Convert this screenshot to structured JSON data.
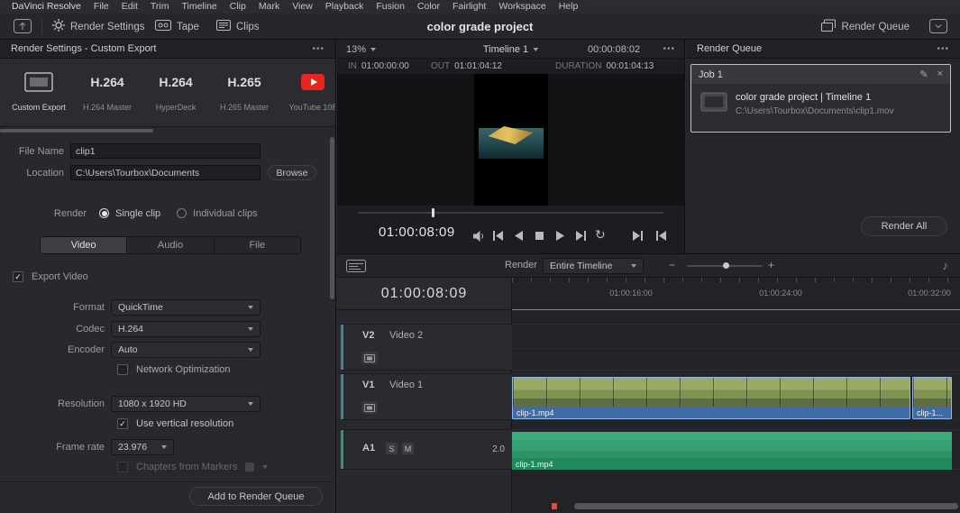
{
  "icons": {
    "more": "•••",
    "loop": "↻",
    "music": "♪",
    "edit": "✎",
    "close": "×",
    "minus": "−",
    "plus": "+",
    "check": "✓"
  },
  "menu": {
    "items": [
      "DaVinci Resolve",
      "File",
      "Edit",
      "Trim",
      "Timeline",
      "Clip",
      "Mark",
      "View",
      "Playback",
      "Fusion",
      "Color",
      "Fairlight",
      "Workspace",
      "Help"
    ]
  },
  "toolbar": {
    "render_settings": "Render Settings",
    "tape": "Tape",
    "clips": "Clips",
    "title": "color grade project",
    "render_queue": "Render Queue"
  },
  "render_settings": {
    "header": "Render Settings - Custom Export",
    "presets": [
      {
        "title": "",
        "caption": "Custom Export"
      },
      {
        "title": "H.264",
        "caption": "H.264 Master"
      },
      {
        "title": "H.264",
        "caption": "HyperDeck"
      },
      {
        "title": "H.265",
        "caption": "H.265 Master"
      },
      {
        "title": "",
        "caption": "YouTube 108"
      }
    ],
    "file_name": {
      "label": "File Name",
      "value": "clip1"
    },
    "location": {
      "label": "Location",
      "value": "C:\\Users\\Tourbox\\Documents",
      "browse": "Browse"
    },
    "render": {
      "label": "Render",
      "single": "Single clip",
      "individual": "Individual clips"
    },
    "tabs": [
      "Video",
      "Audio",
      "File"
    ],
    "export_video": "Export Video",
    "format": {
      "label": "Format",
      "value": "QuickTime"
    },
    "codec": {
      "label": "Codec",
      "value": "H.264"
    },
    "encoder": {
      "label": "Encoder",
      "value": "Auto"
    },
    "network_optimization": "Network Optimization",
    "resolution": {
      "label": "Resolution",
      "value": "1080 x 1920 HD"
    },
    "use_vertical_resolution": "Use vertical resolution",
    "frame_rate": {
      "label": "Frame rate",
      "value": "23.976"
    },
    "chapters_from_markers": "Chapters from Markers",
    "add_to_queue": "Add to Render Queue"
  },
  "viewer": {
    "zoom": "13%",
    "timeline_name": "Timeline 1",
    "timecode": "00:00:08:02",
    "in_label": "IN",
    "in_value": "01:00:00:00",
    "out_label": "OUT",
    "out_value": "01:01:04:12",
    "duration_label": "DURATION",
    "duration_value": "00:01:04:13",
    "transport_timecode": "01:00:08:09"
  },
  "render_queue": {
    "header": "Render Queue",
    "job_title": "Job 1",
    "job_name": "color grade project | Timeline 1",
    "job_path": "C:\\Users\\Tourbox\\Documents\\clip1.mov",
    "render_all": "Render All"
  },
  "timeline": {
    "timecode": "01:00:08:09",
    "render_label": "Render",
    "render_mode": "Entire Timeline",
    "ruler": [
      "01:00:16:00",
      "01:00:24:00",
      "01:00:32:00"
    ],
    "tracks": {
      "v2_id": "V2",
      "v2_name": "Video 2",
      "v1_id": "V1",
      "v1_name": "Video 1",
      "a1_id": "A1",
      "solo": "S",
      "mute": "M",
      "channels": "2.0"
    },
    "clips": {
      "video1": "clip-1.mp4",
      "video2": "clip-1...",
      "audio": "clip-1.mp4"
    }
  },
  "colors": {
    "accent_red": "#d8503f",
    "clip_blue": "#3f6ca6",
    "audio_green": "#2fa070",
    "youtube_red": "#e8261f"
  }
}
